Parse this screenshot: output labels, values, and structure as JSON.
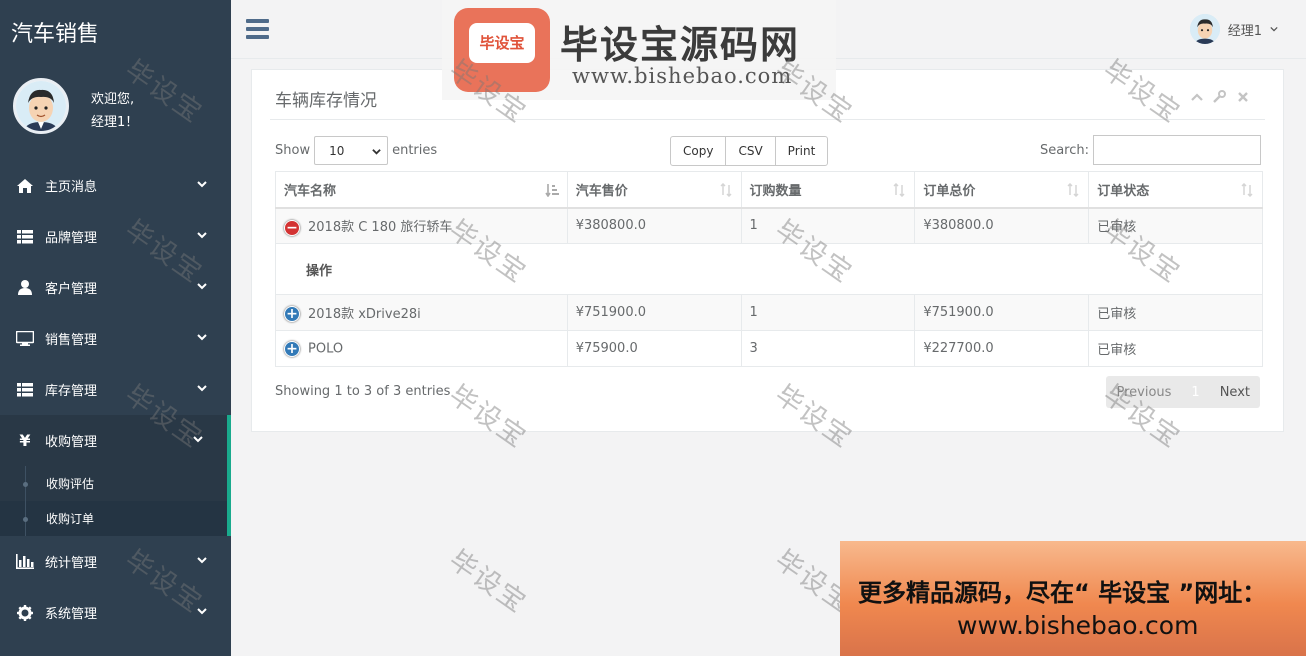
{
  "app": {
    "title": "汽车销售"
  },
  "profile": {
    "welcome": "欢迎您,",
    "user": "经理1！"
  },
  "nav": {
    "items": [
      {
        "label": "主页消息",
        "icon": "home-icon"
      },
      {
        "label": "品牌管理",
        "icon": "list-icon"
      },
      {
        "label": "客户管理",
        "icon": "user-icon"
      },
      {
        "label": "销售管理",
        "icon": "monitor-icon"
      },
      {
        "label": "库存管理",
        "icon": "list-icon"
      },
      {
        "label": "收购管理",
        "icon": "yen-icon"
      },
      {
        "label": "统计管理",
        "icon": "bar-chart-icon"
      },
      {
        "label": "系统管理",
        "icon": "gear-icon"
      }
    ],
    "sub_items": [
      {
        "label": "收购评估"
      },
      {
        "label": "收购订单"
      }
    ]
  },
  "topbar": {
    "user_name": "经理1"
  },
  "watermark_banner": {
    "logo_text": "毕设宝",
    "title": "毕设宝源码网",
    "url": "www.bishebao.com"
  },
  "watermark_text": "毕设宝",
  "panel": {
    "title": "车辆库存情况",
    "show_label": "Show",
    "entries_label": "entries",
    "page_length": "10",
    "buttons": {
      "copy": "Copy",
      "csv": "CSV",
      "print": "Print"
    },
    "search_label": "Search:",
    "search_value": ""
  },
  "table": {
    "headers": [
      "汽车名称",
      "汽车售价",
      "订购数量",
      "订单总价",
      "订单状态"
    ],
    "rows": [
      {
        "name": "2018款 C 180 旅行轿车",
        "price": "¥380800.0",
        "qty": "1",
        "total": "¥380800.0",
        "status": "已审核"
      },
      {
        "name": "2018款 xDrive28i",
        "price": "¥751900.0",
        "qty": "1",
        "total": "¥751900.0",
        "status": "已审核"
      },
      {
        "name": "POLO",
        "price": "¥75900.0",
        "qty": "3",
        "total": "¥227700.0",
        "status": "已审核"
      }
    ],
    "child_row_label": "操作"
  },
  "footer": {
    "info": "Showing 1 to 3 of 3 entries",
    "prev": "Previous",
    "current_page": "1",
    "next": "Next"
  },
  "promo": {
    "line1": "更多精品源码，尽在“ 毕设宝 ”网址：",
    "line2": "www.bishebao.com"
  },
  "colors": {
    "sidebar": "#2f4050",
    "accent": "#19aa8d",
    "minus": "#d33333",
    "plus": "#337ab7"
  }
}
